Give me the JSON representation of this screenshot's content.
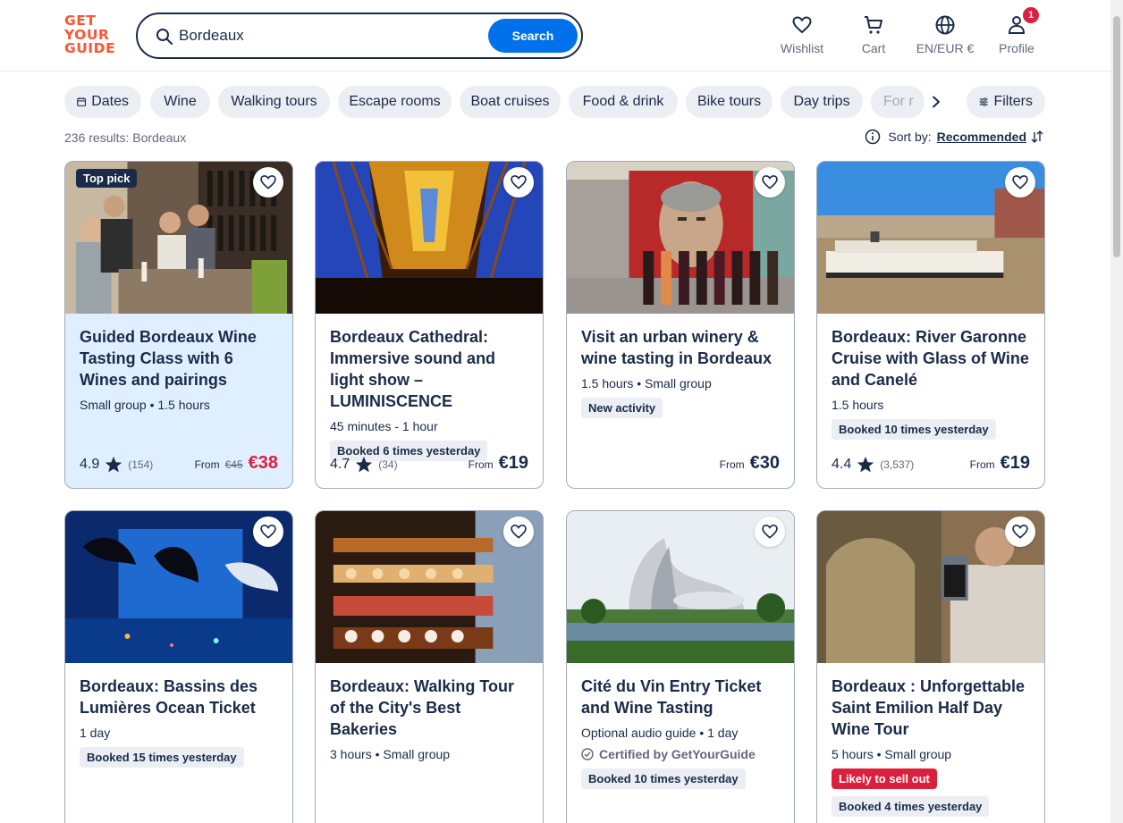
{
  "brand": {
    "logo_line1": "GET",
    "logo_line2": "YOUR",
    "logo_line3": "GUIDE",
    "color": "#ff5533"
  },
  "search": {
    "value": "Bordeaux",
    "button_label": "Search"
  },
  "nav": {
    "wishlist": "Wishlist",
    "cart": "Cart",
    "language": "EN/EUR €",
    "profile": "Profile",
    "profile_badge": "1"
  },
  "chips": [
    "Dates",
    "Wine",
    "Walking tours",
    "Escape rooms",
    "Boat cruises",
    "Food & drink",
    "Bike tours",
    "Day trips",
    "For r"
  ],
  "filters_label": "Filters",
  "results": {
    "count_text": "236 results: Bordeaux",
    "sort_label": "Sort by:",
    "sort_value": "Recommended"
  },
  "cards": [
    {
      "badge": "Top pick",
      "title": "Guided Bordeaux Wine Tasting Class with 6 Wines and pairings",
      "meta": "Small group • 1.5 hours",
      "rating": "4.9",
      "reviews": "(154)",
      "from": "From",
      "old_price": "€45",
      "price": "€38"
    },
    {
      "title": "Bordeaux Cathedral: Immersive sound and light show – LUMINISCENCE",
      "meta": "45 minutes - 1 hour",
      "tag": "Booked 6 times yesterday",
      "rating": "4.7",
      "reviews": "(34)",
      "from": "From",
      "price": "€19"
    },
    {
      "title": "Visit an urban winery & wine tasting in Bordeaux",
      "meta": "1.5 hours • Small group",
      "tag": "New activity",
      "from": "From",
      "price": "€30"
    },
    {
      "title": "Bordeaux: River Garonne Cruise with Glass of Wine and Canelé",
      "meta": "1.5 hours",
      "tag": "Booked 10 times yesterday",
      "rating": "4.4",
      "reviews": "(3,537)",
      "from": "From",
      "price": "€19"
    },
    {
      "title": "Bordeaux: Bassins des Lumières Ocean Ticket",
      "meta": "1 day",
      "tag": "Booked 15 times yesterday"
    },
    {
      "title": "Bordeaux: Walking Tour of the City's Best Bakeries",
      "meta": "3 hours • Small group"
    },
    {
      "title": "Cité du Vin Entry Ticket and Wine Tasting",
      "meta": "Optional audio guide • 1 day",
      "certified": "Certified by GetYourGuide",
      "tag": "Booked 10 times yesterday"
    },
    {
      "title": "Bordeaux : Unforgettable Saint Emilion Half Day Wine Tour",
      "meta": "5 hours • Small group",
      "tag_red": "Likely to sell out",
      "tag": "Booked 4 times yesterday"
    }
  ]
}
